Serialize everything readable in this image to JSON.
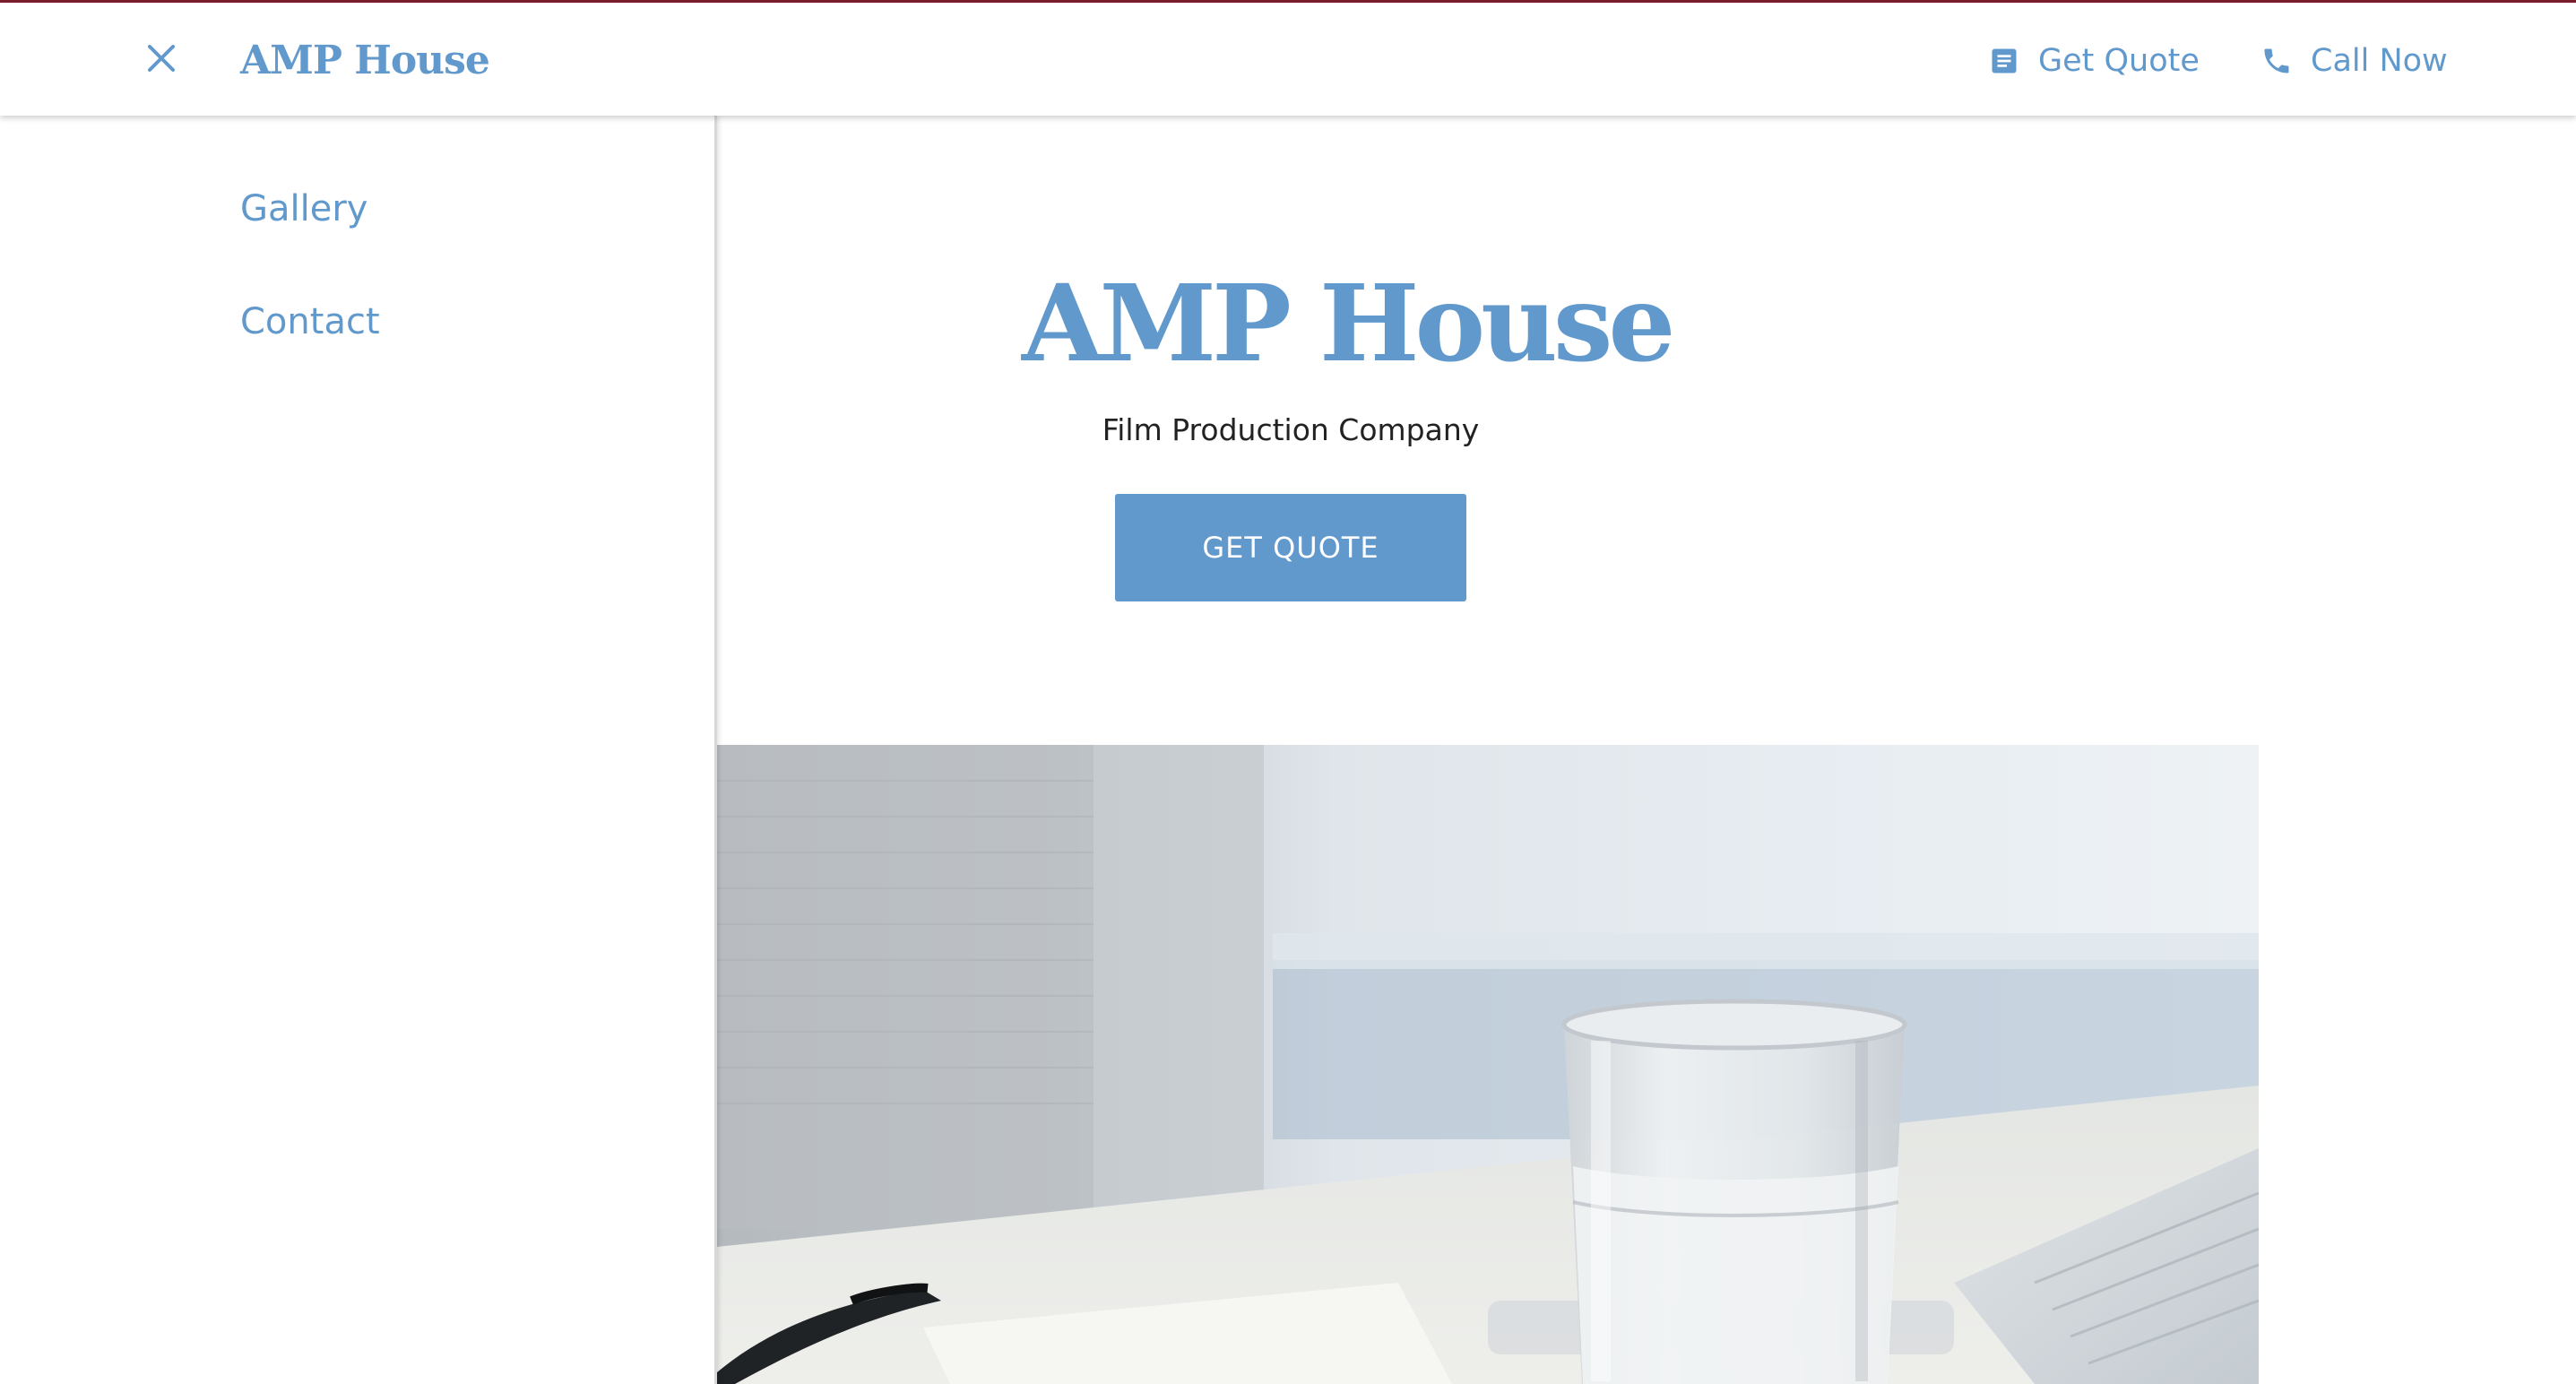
{
  "header": {
    "brand": "AMP House",
    "close_icon": "close-icon",
    "links": [
      {
        "label": "Get Quote",
        "icon": "form-icon"
      },
      {
        "label": "Call Now",
        "icon": "phone-icon"
      }
    ]
  },
  "sidebar": {
    "items": [
      {
        "label": "Gallery"
      },
      {
        "label": "Contact"
      }
    ]
  },
  "hero": {
    "title": "AMP House",
    "subtitle": "Film Production Company",
    "cta_label": "GET QUOTE"
  },
  "colors": {
    "accent": "#6199cd",
    "top_border": "#7a1f2b",
    "text_dark": "#222222"
  }
}
